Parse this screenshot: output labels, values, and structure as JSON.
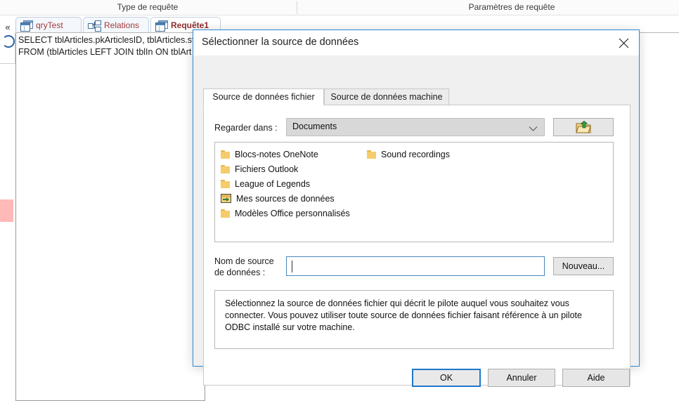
{
  "ribbon": {
    "groups": [
      {
        "label": "Type de requête"
      },
      {
        "label": "Paramètres de requête"
      }
    ]
  },
  "navpane": {
    "collapse_chevron": "«"
  },
  "doc_tabs": [
    {
      "label": "qryTest",
      "icon": "query-datasheet-icon",
      "active": false
    },
    {
      "label": "Relations",
      "icon": "relations-icon",
      "active": false
    },
    {
      "label": "Requête1",
      "icon": "query-datasheet-icon",
      "active": true
    }
  ],
  "sql": {
    "line1": "SELECT tblArticles.pkArticlesID, tblArticles.st",
    "line2": "FROM (tblArticles LEFT JOIN tblIn ON tblArt"
  },
  "dialog": {
    "title": "Sélectionner la source de données",
    "close_icon": "close-icon",
    "tabs": [
      {
        "label": "Source de données fichier",
        "selected": true
      },
      {
        "label": "Source de données machine",
        "selected": false
      }
    ],
    "lookin": {
      "label": "Regarder dans :",
      "value": "Documents",
      "arrow_icon": "chevron-down-icon",
      "up_button_icon": "folder-up-icon"
    },
    "file_list": {
      "column_1": [
        {
          "name": "Blocs-notes OneNote",
          "icon": "folder-icon"
        },
        {
          "name": "Fichiers Outlook",
          "icon": "folder-icon"
        },
        {
          "name": "League of Legends",
          "icon": "folder-icon"
        },
        {
          "name": "Mes sources de données",
          "icon": "data-source-folder-icon"
        },
        {
          "name": "Modèles Office personnalisés",
          "icon": "folder-icon"
        }
      ],
      "column_2": [
        {
          "name": "Sound recordings",
          "icon": "folder-icon"
        }
      ]
    },
    "dsn": {
      "label_line1": "Nom de source",
      "label_line2": "de données :",
      "value": "",
      "placeholder": "",
      "new_button": "Nouveau..."
    },
    "description": "Sélectionnez la source de données fichier qui décrit le pilote auquel vous souhaitez vous connecter. Vous pouvez utiliser toute source de données fichier faisant référence à un pilote ODBC installé sur votre machine.",
    "footer": {
      "ok": "OK",
      "cancel": "Annuler",
      "help": "Aide"
    }
  },
  "colors": {
    "dialog_border": "#2e8ad4",
    "focus_blue": "#1f78c8",
    "tab_label": "#a23b3b",
    "folder_yellow": "#f5cb6b",
    "nav_marker": "#ffb9b9"
  }
}
